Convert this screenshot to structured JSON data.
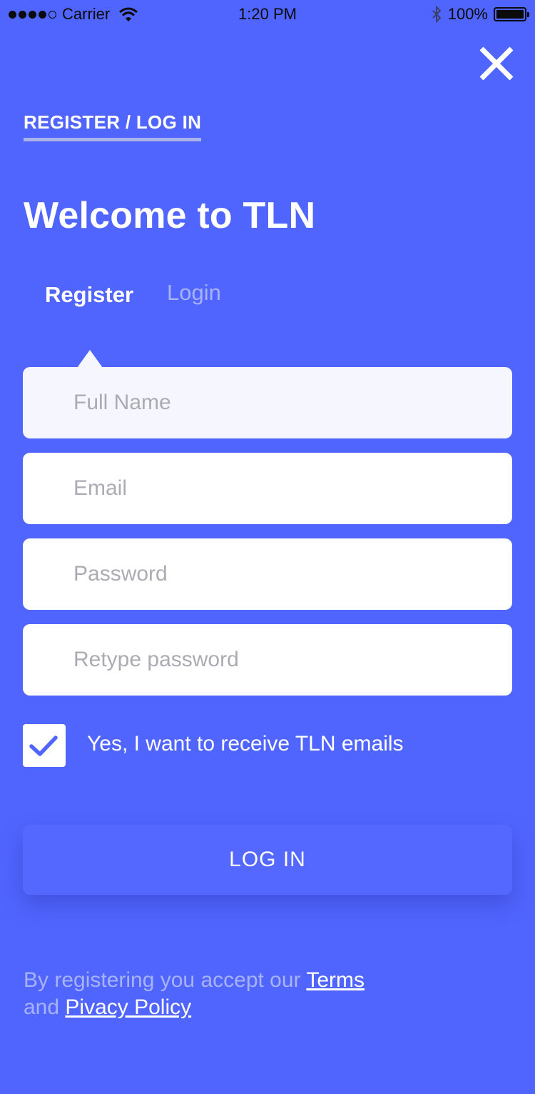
{
  "status_bar": {
    "carrier": "Carrier",
    "time": "1:20 PM",
    "battery": "100%",
    "signal_icon": "signal-dots-icon",
    "wifi_icon": "wifi-icon",
    "bluetooth_icon": "bluetooth-icon",
    "battery_icon": "battery-icon"
  },
  "header": {
    "close_icon": "close-icon",
    "link": "REGISTER / LOG IN",
    "title": "Welcome to TLN"
  },
  "tabs": {
    "register": "Register",
    "login": "Login",
    "active": "register"
  },
  "form": {
    "full_name_placeholder": "Full Name",
    "email_placeholder": "Email",
    "password_placeholder": "Password",
    "retype_placeholder": "Retype password",
    "newsletter_label": "Yes, I want to receive TLN emails",
    "newsletter_checked": true
  },
  "button": {
    "label": "LOG IN"
  },
  "footer": {
    "text_before_terms": "By registering you accept our",
    "terms": "Terms",
    "text_and": "and",
    "privacy": "Pivacy Policy"
  },
  "colors": {
    "background": "#5065FE",
    "checkmark": "#5065FE",
    "muted_text": "#A8B2F6",
    "field_first_bg": "#F6F7FE",
    "underline": "#A9B3EB"
  }
}
